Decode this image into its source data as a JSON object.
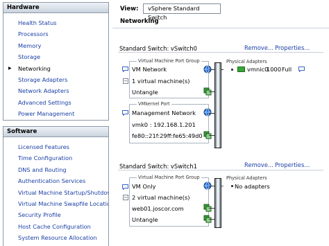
{
  "hardware": {
    "title": "Hardware",
    "items": [
      {
        "label": "Health Status"
      },
      {
        "label": "Processors"
      },
      {
        "label": "Memory"
      },
      {
        "label": "Storage"
      },
      {
        "label": "Networking",
        "selected": true
      },
      {
        "label": "Storage Adapters"
      },
      {
        "label": "Network Adapters"
      },
      {
        "label": "Advanced Settings"
      },
      {
        "label": "Power Management"
      }
    ]
  },
  "software": {
    "title": "Software",
    "items": [
      {
        "label": "Licensed Features"
      },
      {
        "label": "Time Configuration"
      },
      {
        "label": "DNS and Routing"
      },
      {
        "label": "Authentication Services"
      },
      {
        "label": "Virtual Machine Startup/Shutdown"
      },
      {
        "label": "Virtual Machine Swapfile Location"
      },
      {
        "label": "Security Profile"
      },
      {
        "label": "Host Cache Configuration"
      },
      {
        "label": "System Resource Allocation"
      }
    ]
  },
  "view": {
    "label": "View:",
    "value": "vSphere Standard Switch"
  },
  "networking_title": "Networking",
  "switch0": {
    "title": "Standard Switch: vSwitch0",
    "remove": "Remove...",
    "properties": "Properties...",
    "vm_pg_caption": "Virtual Machine Port Group",
    "vm_pg_name": "VM Network",
    "vm_count": "1 virtual machine(s)",
    "vm1": "Untangle",
    "vmk_caption": "VMkernel Port",
    "vmk_name": "Management Network",
    "vmk_ip": "vmk0 : 192.168.1.201",
    "vmk_ipv6": "fe80::21f:29ff:fe65:49d0",
    "phys_caption": "Physical Adapters",
    "nic_name": "vmnic0",
    "nic_speed": "1000",
    "nic_duplex": "Full"
  },
  "switch1": {
    "title": "Standard Switch: vSwitch1",
    "remove": "Remove...",
    "properties": "Properties...",
    "vm_pg_caption": "Virtual Machine Port Group",
    "vm_pg_name": "VM Only",
    "vm_count": "2 virtual machine(s)",
    "vm1": "web01.joscor.com",
    "vm2": "Untangle",
    "phys_caption": "Physical Adapters",
    "no_adapters": "No adapters"
  },
  "colors": {
    "link": "#1a3fa6",
    "panel_border": "#8d99a8",
    "nic_green": "#37a637"
  }
}
